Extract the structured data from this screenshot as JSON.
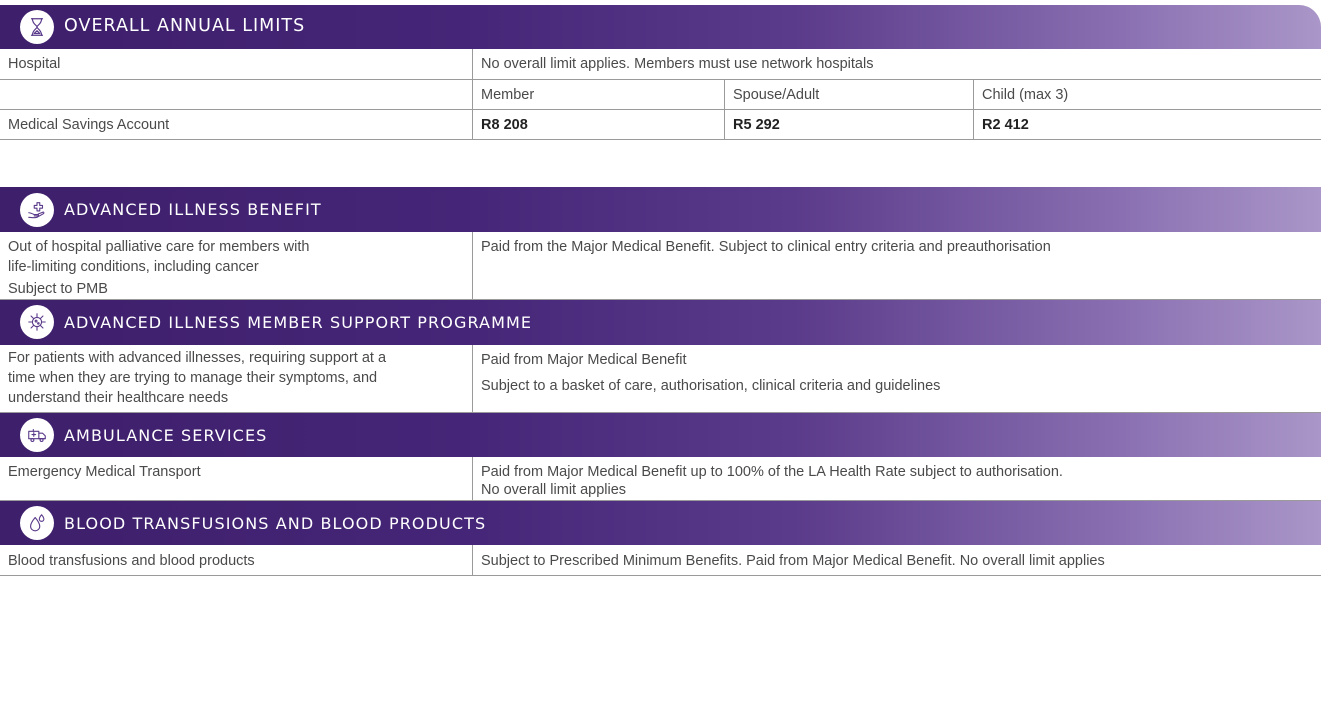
{
  "sections": [
    {
      "title": "OVERALL ANNUAL LIMITS",
      "icon": "hourglass-icon",
      "rows": [
        {
          "label": "Hospital",
          "value": "No overall limit applies. Members must use network hospitals"
        },
        {
          "label": "",
          "member": "Member",
          "spouse": "Spouse/Adult",
          "child": "Child (max 3)"
        },
        {
          "label": "Medical Savings Account",
          "member": "R8 208",
          "spouse": "R5 292",
          "child": "R2 412"
        }
      ]
    },
    {
      "title": "ADVANCED ILLNESS BENEFIT",
      "icon": "hand-cross-icon",
      "rows": [
        {
          "label_line1": "Out of hospital palliative care for members with",
          "label_line2": "life-limiting conditions, including cancer",
          "label_line3": "Subject to PMB",
          "value": "Paid from the Major Medical Benefit. Subject to clinical entry criteria and preauthorisation"
        }
      ]
    },
    {
      "title": "ADVANCED ILLNESS MEMBER SUPPORT PROGRAMME",
      "icon": "virus-icon",
      "rows": [
        {
          "label_line1": "For patients with advanced illnesses, requiring support at a",
          "label_line2": "time when they are trying to manage their symptoms, and",
          "label_line3": "understand their healthcare needs",
          "value_line1": "Paid from Major Medical Benefit",
          "value_line2": "Subject to a basket of care, authorisation, clinical criteria and guidelines"
        }
      ]
    },
    {
      "title": "AMBULANCE SERVICES",
      "icon": "ambulance-icon",
      "rows": [
        {
          "label": "Emergency Medical Transport",
          "value_line1": "Paid from Major Medical Benefit up to 100% of the LA Health Rate subject to authorisation.",
          "value_line2": "No overall limit applies"
        }
      ]
    },
    {
      "title": "BLOOD TRANSFUSIONS AND BLOOD PRODUCTS",
      "icon": "droplets-icon",
      "rows": [
        {
          "label": "Blood transfusions and blood products",
          "value": "Subject to Prescribed Minimum Benefits. Paid from Major Medical Benefit. No overall limit applies"
        }
      ]
    }
  ],
  "colors": {
    "header_start": "#3e1f6b",
    "header_end": "#aa96c8",
    "icon_stroke": "#5a3a8a",
    "text": "#4a4a4a",
    "rule": "#9a9a9a"
  }
}
